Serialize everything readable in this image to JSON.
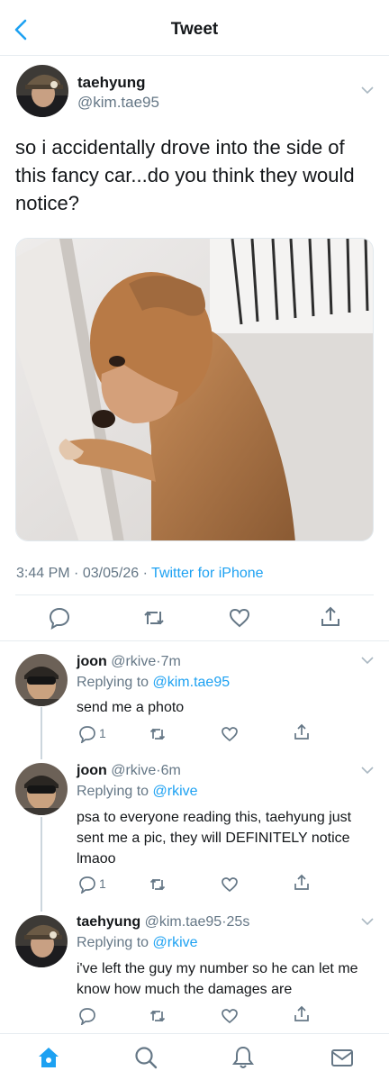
{
  "header": {
    "title": "Tweet"
  },
  "tweet": {
    "name": "taehyung",
    "handle": "@kim.tae95",
    "text": "so i accidentally drove into the side of this fancy car...do you think they would notice?",
    "time": "3:44 PM",
    "date": "03/05/26",
    "source": "Twitter for iPhone",
    "separator": "·"
  },
  "replies": [
    {
      "name": "joon",
      "handle": "@rkive",
      "time": "7m",
      "replying_label": "Replying to",
      "replying_to": "@kim.tae95",
      "text": "send me a photo",
      "reply_count": "1"
    },
    {
      "name": "joon",
      "handle": "@rkive",
      "time": "6m",
      "replying_label": "Replying to",
      "replying_to": "@rkive",
      "text": "psa to everyone reading this, taehyung just sent me a pic, they will DEFINITELY notice lmaoo",
      "reply_count": "1"
    },
    {
      "name": "taehyung",
      "handle": "@kim.tae95",
      "time": "25s",
      "replying_label": "Replying to",
      "replying_to": "@rkive",
      "text": "i've left the guy my number so he can let me know how much the damages are",
      "reply_count": ""
    }
  ],
  "tabbar": [
    "home-icon",
    "search-icon",
    "notifications-icon",
    "messages-icon"
  ],
  "colors": {
    "accent": "#1da1f2",
    "secondary_text": "#657786",
    "divider": "#e6ecf0"
  }
}
